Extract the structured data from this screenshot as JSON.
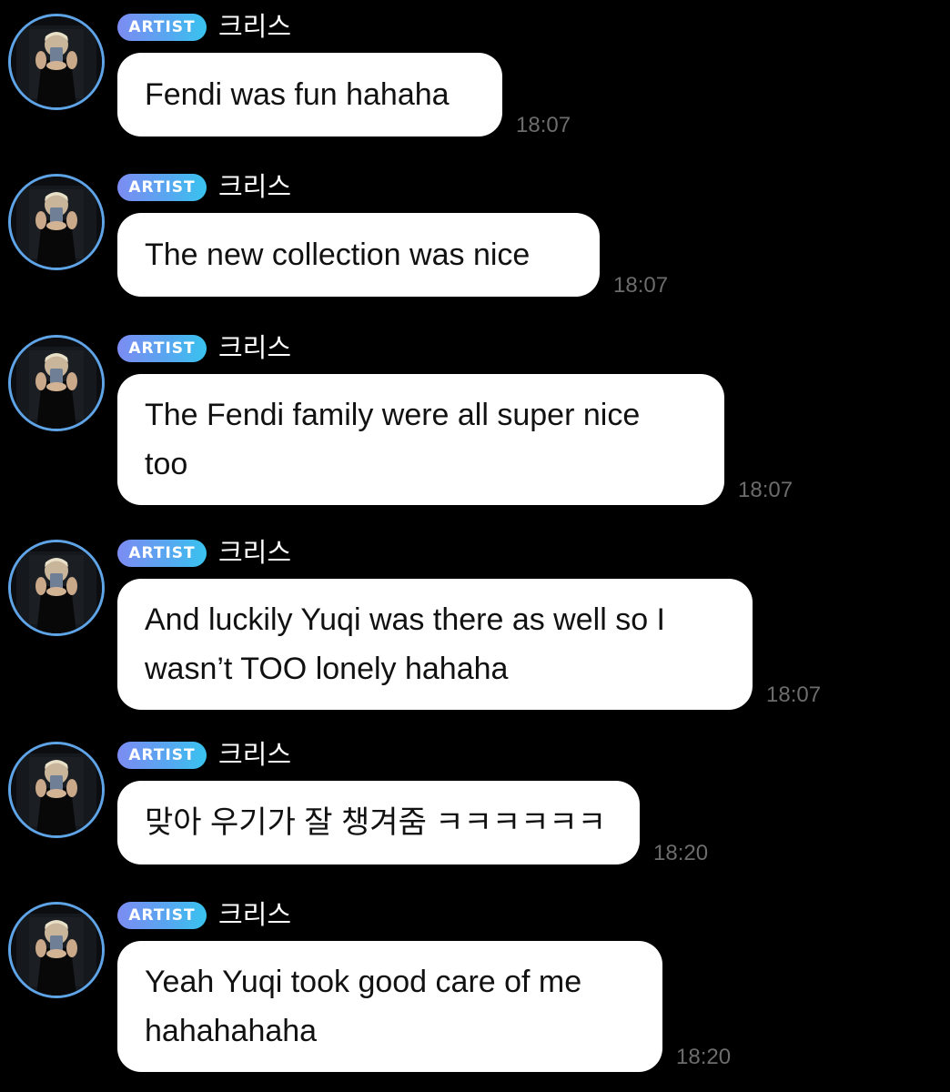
{
  "messages": [
    {
      "badge": "ARTIST",
      "sender": "크리스",
      "lines": [
        "Fendi was fun hahaha"
      ],
      "time": "18:07"
    },
    {
      "badge": "ARTIST",
      "sender": "크리스",
      "lines": [
        "The new collection was nice"
      ],
      "time": "18:07"
    },
    {
      "badge": "ARTIST",
      "sender": "크리스",
      "lines": [
        "The Fendi family were all super nice",
        "too"
      ],
      "time": "18:07"
    },
    {
      "badge": "ARTIST",
      "sender": "크리스",
      "lines": [
        "And luckily Yuqi was there as well so I",
        "wasn’t TOO lonely hahaha"
      ],
      "time": "18:07"
    },
    {
      "badge": "ARTIST",
      "sender": "크리스",
      "lines": [
        "맞아 우기가 잘 챙겨줌 ㅋㅋㅋㅋㅋㅋ"
      ],
      "time": "18:20"
    },
    {
      "badge": "ARTIST",
      "sender": "크리스",
      "lines": [
        "Yeah Yuqi took good care of me",
        "hahahahaha"
      ],
      "time": "18:20"
    }
  ],
  "avatar_icon": "artist-profile-photo",
  "colors": {
    "background": "#000000",
    "bubble": "#ffffff",
    "badge_start": "#7c8cf2",
    "badge_end": "#38c3ee",
    "avatar_ring": "#5fa4e6",
    "timestamp": "#6c6c6c"
  }
}
